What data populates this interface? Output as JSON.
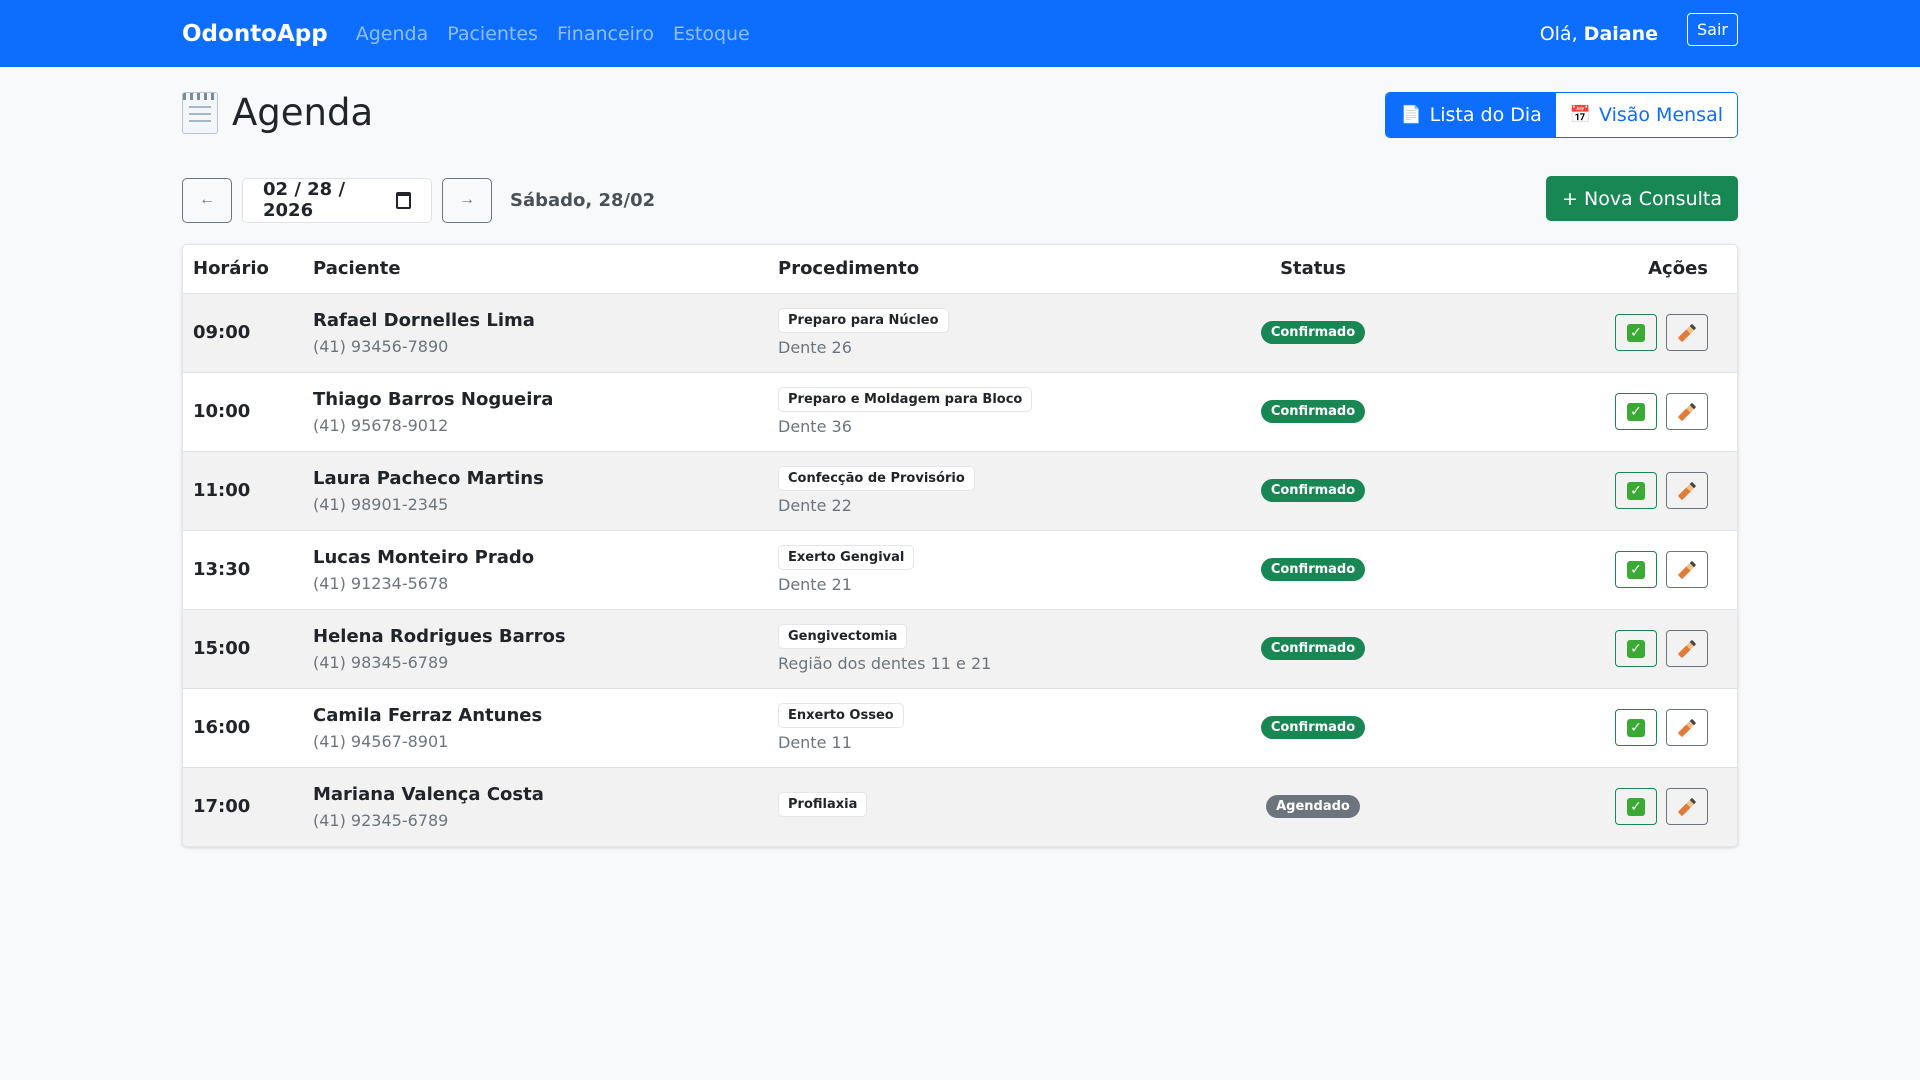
{
  "navbar": {
    "brand": "OdontoApp",
    "links": [
      "Agenda",
      "Pacientes",
      "Financeiro",
      "Estoque"
    ],
    "greeting_prefix": "Olá,",
    "user_name": "Daiane",
    "logout_label": "Sair"
  },
  "header": {
    "title": "Agenda",
    "title_icon": "notepad-icon",
    "view_toggle": {
      "day_label": "Lista do Dia",
      "day_icon": "page-icon",
      "month_label": "Visão Mensal",
      "month_icon": "calendar-icon",
      "active": "day"
    }
  },
  "date_bar": {
    "prev_label": "←",
    "next_label": "→",
    "date_value": "02 / 28 / 2026",
    "day_label": "Sábado, 28/02",
    "new_button_label": "+ Nova Consulta"
  },
  "table": {
    "headers": {
      "time": "Horário",
      "patient": "Paciente",
      "procedure": "Procedimento",
      "status": "Status",
      "actions": "Ações"
    },
    "rows": [
      {
        "time": "09:00",
        "name": "Rafael Dornelles Lima",
        "phone": "(41) 93456-7890",
        "procedure": "Preparo para Núcleo",
        "note": "Dente 26",
        "status": "Confirmado"
      },
      {
        "time": "10:00",
        "name": "Thiago Barros Nogueira",
        "phone": "(41) 95678-9012",
        "procedure": "Preparo e Moldagem para Bloco",
        "note": "Dente 36",
        "status": "Confirmado"
      },
      {
        "time": "11:00",
        "name": "Laura Pacheco Martins",
        "phone": "(41) 98901-2345",
        "procedure": "Confecção de Provisório",
        "note": "Dente 22",
        "status": "Confirmado"
      },
      {
        "time": "13:30",
        "name": "Lucas Monteiro Prado",
        "phone": "(41) 91234-5678",
        "procedure": "Exerto Gengival",
        "note": "Dente 21",
        "status": "Confirmado"
      },
      {
        "time": "15:00",
        "name": "Helena Rodrigues Barros",
        "phone": "(41) 98345-6789",
        "procedure": "Gengivectomia",
        "note": "Região dos dentes 11 e 21",
        "status": "Confirmado"
      },
      {
        "time": "16:00",
        "name": "Camila Ferraz Antunes",
        "phone": "(41) 94567-8901",
        "procedure": "Enxerto Osseo",
        "note": "Dente 11",
        "status": "Confirmado"
      },
      {
        "time": "17:00",
        "name": "Mariana Valença Costa",
        "phone": "(41) 92345-6789",
        "procedure": "Profilaxia",
        "note": "",
        "status": "Agendado"
      }
    ]
  },
  "colors": {
    "primary": "#0d6efd",
    "success": "#198754",
    "secondary": "#6c757d"
  }
}
